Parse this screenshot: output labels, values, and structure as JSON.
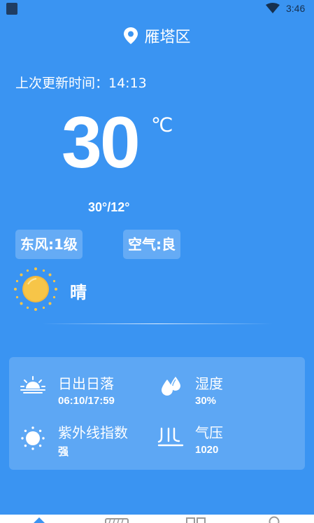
{
  "status_bar": {
    "time": "3:46"
  },
  "header": {
    "location": "雁塔区"
  },
  "update": {
    "label": "上次更新时间：14:13"
  },
  "current": {
    "temperature": "30",
    "unit": "℃",
    "range": "30°/12°",
    "wind": "东风:1级",
    "air": "空气:良",
    "condition": "晴"
  },
  "details": [
    {
      "label": "日出日落",
      "value": "06:10/17:59",
      "icon": "sunrise-icon"
    },
    {
      "label": "湿度",
      "value": "30%",
      "icon": "humidity-icon"
    },
    {
      "label": "紫外线指数",
      "value": "强",
      "icon": "uv-icon"
    },
    {
      "label": "气压",
      "value": "1020",
      "icon": "pressure-icon"
    }
  ],
  "colors": {
    "background": "#3a94f2",
    "sun": "#f7c548",
    "status_text": "#16304f"
  },
  "tabs": [
    {
      "icon": "home-icon"
    },
    {
      "icon": "forecast-icon"
    },
    {
      "icon": "grid-icon"
    },
    {
      "icon": "profile-icon"
    }
  ]
}
